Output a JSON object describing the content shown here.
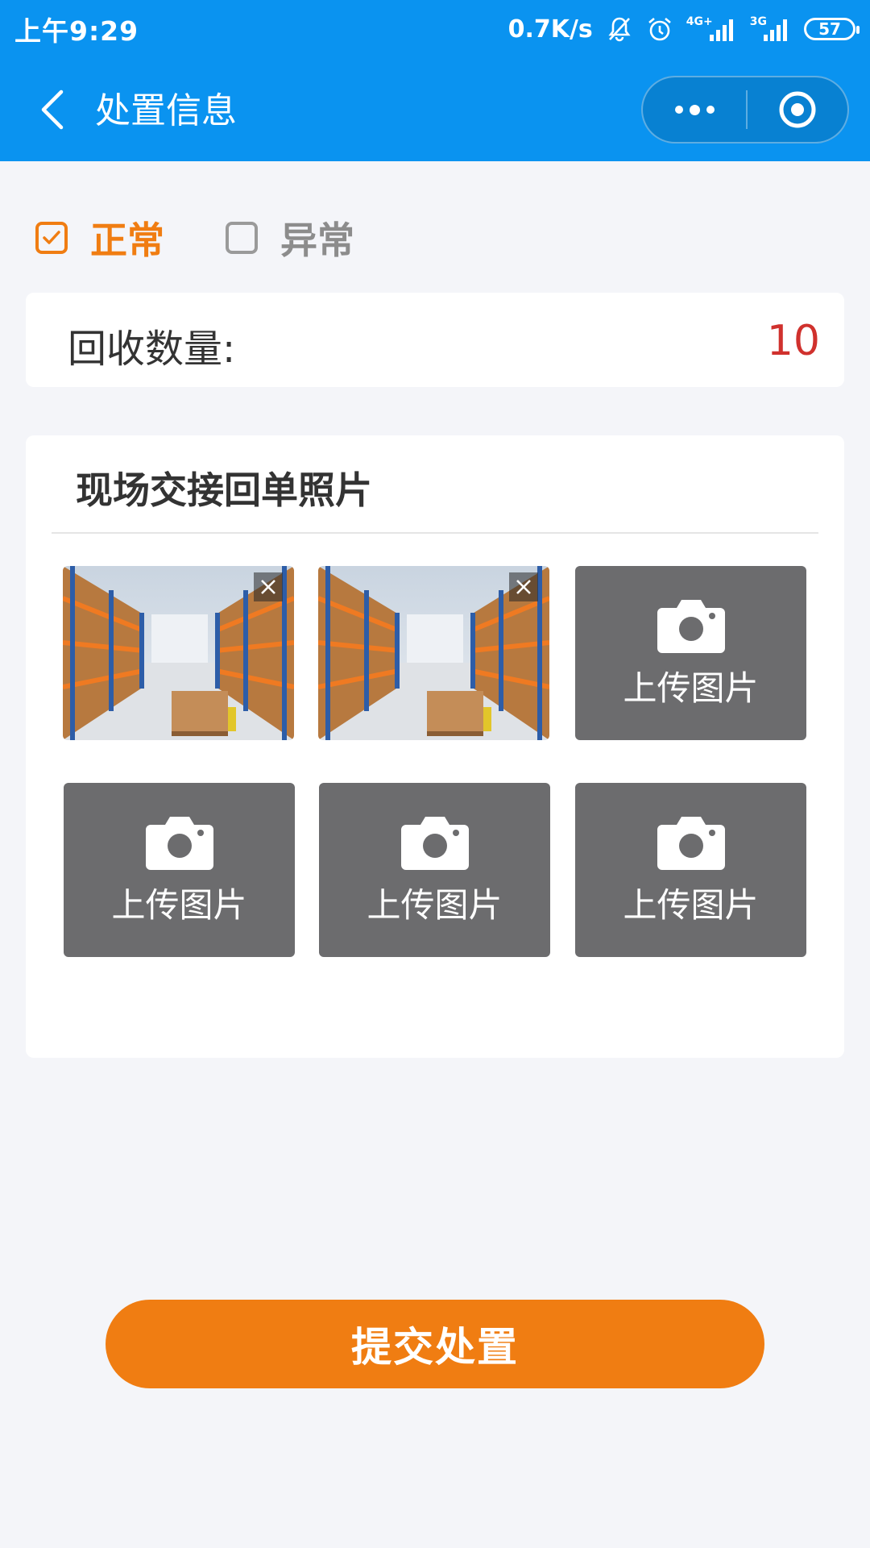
{
  "status_bar": {
    "time": "上午9:29",
    "net_speed": "0.7K/s",
    "signal_1_label": "4G+",
    "signal_2_label": "3G",
    "battery": "57"
  },
  "nav": {
    "title": "处置信息"
  },
  "status_options": [
    {
      "label": "正常",
      "checked": true
    },
    {
      "label": "异常",
      "checked": false
    }
  ],
  "quantity": {
    "label": "回收数量:",
    "value": "10"
  },
  "photos": {
    "title": "现场交接回单照片",
    "upload_label": "上传图片",
    "uploaded_count": 2,
    "slots": 6
  },
  "submit_label": "提交处置",
  "colors": {
    "primary_blue": "#0a93f0",
    "accent_orange": "#f07d12",
    "value_red": "#d0312d",
    "upload_tile_gray": "#6c6c6e"
  }
}
